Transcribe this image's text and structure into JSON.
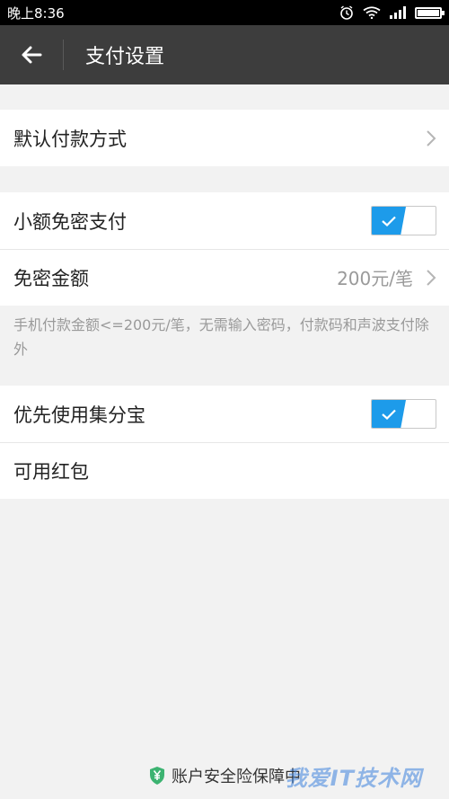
{
  "status_bar": {
    "time": "晚上8:36",
    "icons": [
      "alarm-icon",
      "wifi-icon",
      "signal-icon",
      "battery-icon"
    ]
  },
  "header": {
    "back_icon": "arrow-left-icon",
    "title": "支付设置"
  },
  "sections": {
    "default_payment": {
      "label": "默认付款方式"
    },
    "small_amount": {
      "label": "小额免密支付",
      "enabled": true
    },
    "free_amount": {
      "label": "免密金额",
      "value": "200元/笔"
    },
    "hint": "手机付款金额<=200元/笔，无需输入密码，付款码和声波支付除外",
    "jifenbao": {
      "label": "优先使用集分宝",
      "enabled": true
    },
    "red_packet": {
      "label": "可用红包"
    }
  },
  "footer": {
    "text": "账户安全险保障中",
    "icon": "shield-yen-icon"
  },
  "watermark": {
    "text": "我爱IT技术网"
  },
  "colors": {
    "accent": "#1d9bea",
    "header_bg": "#3d3d3d",
    "page_bg": "#f2f2f2",
    "shield_green": "#3cb371"
  }
}
